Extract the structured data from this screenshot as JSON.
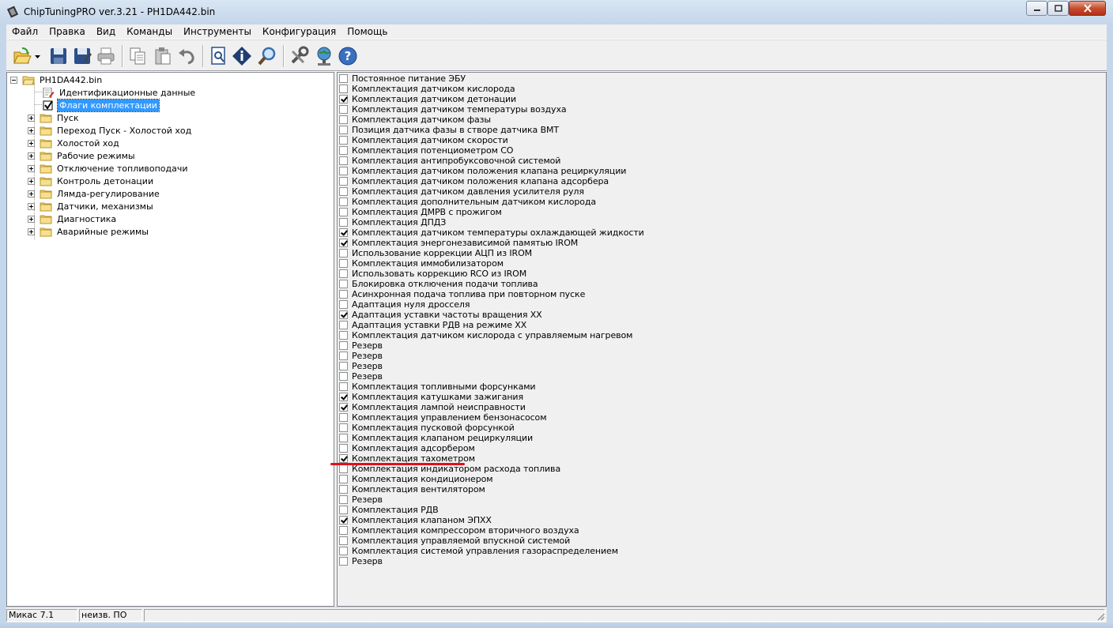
{
  "window": {
    "title": "ChipTuningPRO ver.3.21 - PH1DA442.bin"
  },
  "menu": [
    "Файл",
    "Правка",
    "Вид",
    "Команды",
    "Инструменты",
    "Конфигурация",
    "Помощь"
  ],
  "toolbar": {
    "icons": [
      "open-icon",
      "dropdown-arrow-icon",
      "save-icon",
      "save-as-icon",
      "print-icon",
      "copy-icon",
      "paste-icon",
      "undo-icon",
      "document-search-icon",
      "info-icon",
      "search-icon",
      "tools-icon",
      "globe-network-icon",
      "help-icon"
    ]
  },
  "tree": {
    "root": "PH1DA442.bin",
    "children": [
      {
        "label": "Идентификационные данные",
        "type": "doc"
      },
      {
        "label": "Флаги комплектации",
        "type": "check",
        "selected": true
      },
      {
        "label": "Пуск",
        "type": "folder"
      },
      {
        "label": "Переход Пуск - Холостой ход",
        "type": "folder"
      },
      {
        "label": "Холостой ход",
        "type": "folder"
      },
      {
        "label": "Рабочие режимы",
        "type": "folder"
      },
      {
        "label": "Отключение топливоподачи",
        "type": "folder"
      },
      {
        "label": "Контроль детонации",
        "type": "folder"
      },
      {
        "label": "Лямда-регулирование",
        "type": "folder"
      },
      {
        "label": "Датчики, механизмы",
        "type": "folder"
      },
      {
        "label": "Диагностика",
        "type": "folder"
      },
      {
        "label": "Аварийные режимы",
        "type": "folder"
      }
    ]
  },
  "flags": [
    {
      "label": "Постоянное питание ЭБУ",
      "checked": false
    },
    {
      "label": "Комплектация датчиком кислорода",
      "checked": false
    },
    {
      "label": "Комплектация датчиком детонации",
      "checked": true
    },
    {
      "label": "Комплектация датчиком температуры воздуха",
      "checked": false
    },
    {
      "label": "Комплектация датчиком фазы",
      "checked": false
    },
    {
      "label": "Позиция датчика фазы в створе датчика ВМТ",
      "checked": false
    },
    {
      "label": "Комплектация датчиком скорости",
      "checked": false
    },
    {
      "label": "Комплектация потенциометром СО",
      "checked": false
    },
    {
      "label": "Комплектация антипробуксовочной системой",
      "checked": false
    },
    {
      "label": "Комплектация датчиком положения клапана рециркуляции",
      "checked": false
    },
    {
      "label": "Комплектация датчиком положения клапана адсорбера",
      "checked": false
    },
    {
      "label": "Комплектация датчиком давления усилителя руля",
      "checked": false
    },
    {
      "label": "Комплектация дополнительным датчиком кислорода",
      "checked": false
    },
    {
      "label": "Комплектация ДМРВ с прожигом",
      "checked": false
    },
    {
      "label": "Комплектация ДПДЗ",
      "checked": false
    },
    {
      "label": "Комплектация датчиком температуры охлаждающей жидкости",
      "checked": true
    },
    {
      "label": "Комплектация энергонезависимой памятью IROM",
      "checked": true
    },
    {
      "label": "Использование коррекции АЦП из IROM",
      "checked": false
    },
    {
      "label": "Комплектация иммобилизатором",
      "checked": false
    },
    {
      "label": "Использовать коррекцию RCO из IROM",
      "checked": false
    },
    {
      "label": "Блокировка отключения подачи топлива",
      "checked": false
    },
    {
      "label": "Асинхронная подача топлива при повторном пуске",
      "checked": false
    },
    {
      "label": "Адаптация нуля дросселя",
      "checked": false
    },
    {
      "label": "Адаптация уставки частоты вращения ХХ",
      "checked": true
    },
    {
      "label": "Адаптация уставки РДВ на режиме ХХ",
      "checked": false
    },
    {
      "label": "Комплектация датчиком кислорода с управляемым нагревом",
      "checked": false
    },
    {
      "label": "Резерв",
      "checked": false
    },
    {
      "label": "Резерв",
      "checked": false
    },
    {
      "label": "Резерв",
      "checked": false
    },
    {
      "label": "Резерв",
      "checked": false
    },
    {
      "label": "Комплектация топливными форсунками",
      "checked": false
    },
    {
      "label": "Комплектация катушками зажигания",
      "checked": true
    },
    {
      "label": "Комплектация лампой неисправности",
      "checked": true
    },
    {
      "label": "Комплектация управлением бензонасосом",
      "checked": false
    },
    {
      "label": "Комплектация пусковой форсункой",
      "checked": false
    },
    {
      "label": "Комплектация клапаном рециркуляции",
      "checked": false
    },
    {
      "label": "Комплектация адсорбером",
      "checked": false
    },
    {
      "label": "Комплектация тахометром",
      "checked": true
    },
    {
      "label": "Комплектация индикатором расхода топлива",
      "checked": false
    },
    {
      "label": "Комплектация кондиционером",
      "checked": false
    },
    {
      "label": "Комплектация вентилятором",
      "checked": false
    },
    {
      "label": "Резерв",
      "checked": false
    },
    {
      "label": "Комплектация РДВ",
      "checked": false
    },
    {
      "label": "Комплектация клапаном ЭПХХ",
      "checked": true
    },
    {
      "label": "Комплектация компрессором вторичного воздуха",
      "checked": false
    },
    {
      "label": "Комплектация управляемой впускной системой",
      "checked": false
    },
    {
      "label": "Комплектация системой управления газораспределением",
      "checked": false
    },
    {
      "label": "Резерв",
      "checked": false
    }
  ],
  "annotation": {
    "highlight_color": "#e0101a"
  },
  "status": {
    "ecu": "Микас 7.1",
    "software": "неизв. ПО"
  }
}
